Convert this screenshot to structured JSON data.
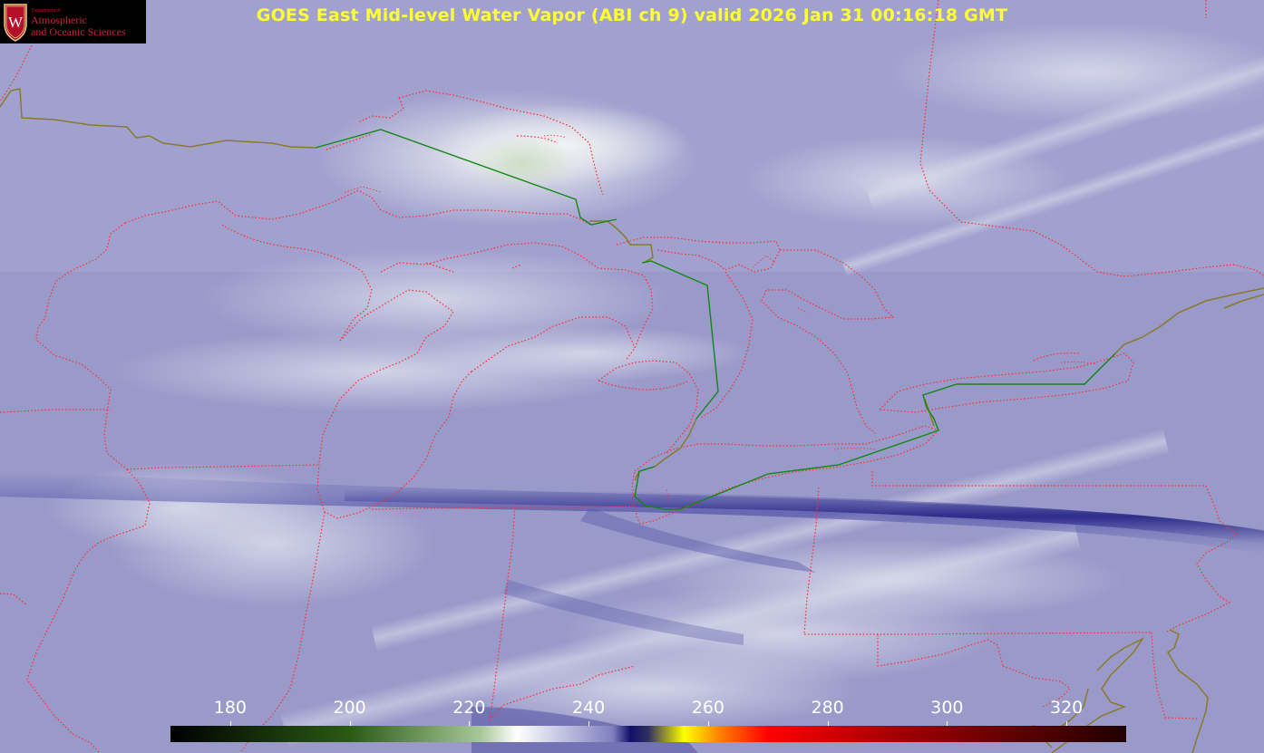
{
  "title": "GOES East Mid-level Water Vapor (ABI ch 9)  valid 2026 Jan 31 00:16:18 GMT",
  "logo": {
    "department": "Department of",
    "line1": "Atmospheric",
    "line2": "and Oceanic Sciences",
    "shield_letter": "W"
  },
  "colorbar": {
    "min": 170,
    "max": 330,
    "ticks": [
      180,
      200,
      220,
      240,
      260,
      280,
      300,
      320
    ],
    "stops": [
      {
        "value": 170,
        "color": "#000000"
      },
      {
        "value": 200,
        "color": "#2a5a14"
      },
      {
        "value": 222,
        "color": "#a8c898"
      },
      {
        "value": 228,
        "color": "#ffffff"
      },
      {
        "value": 244,
        "color": "#8080c0"
      },
      {
        "value": 247,
        "color": "#10106a"
      },
      {
        "value": 250,
        "color": "#303060"
      },
      {
        "value": 256,
        "color": "#ffff00"
      },
      {
        "value": 262,
        "color": "#ff8000"
      },
      {
        "value": 270,
        "color": "#ff0000"
      },
      {
        "value": 292,
        "color": "#a00000"
      },
      {
        "value": 330,
        "color": "#200000"
      }
    ]
  },
  "colors": {
    "background": "#9b9bc9",
    "state_borders": "#ff3030",
    "international_border": "#008800",
    "coastline": "#807020",
    "title": "#ffff33"
  }
}
